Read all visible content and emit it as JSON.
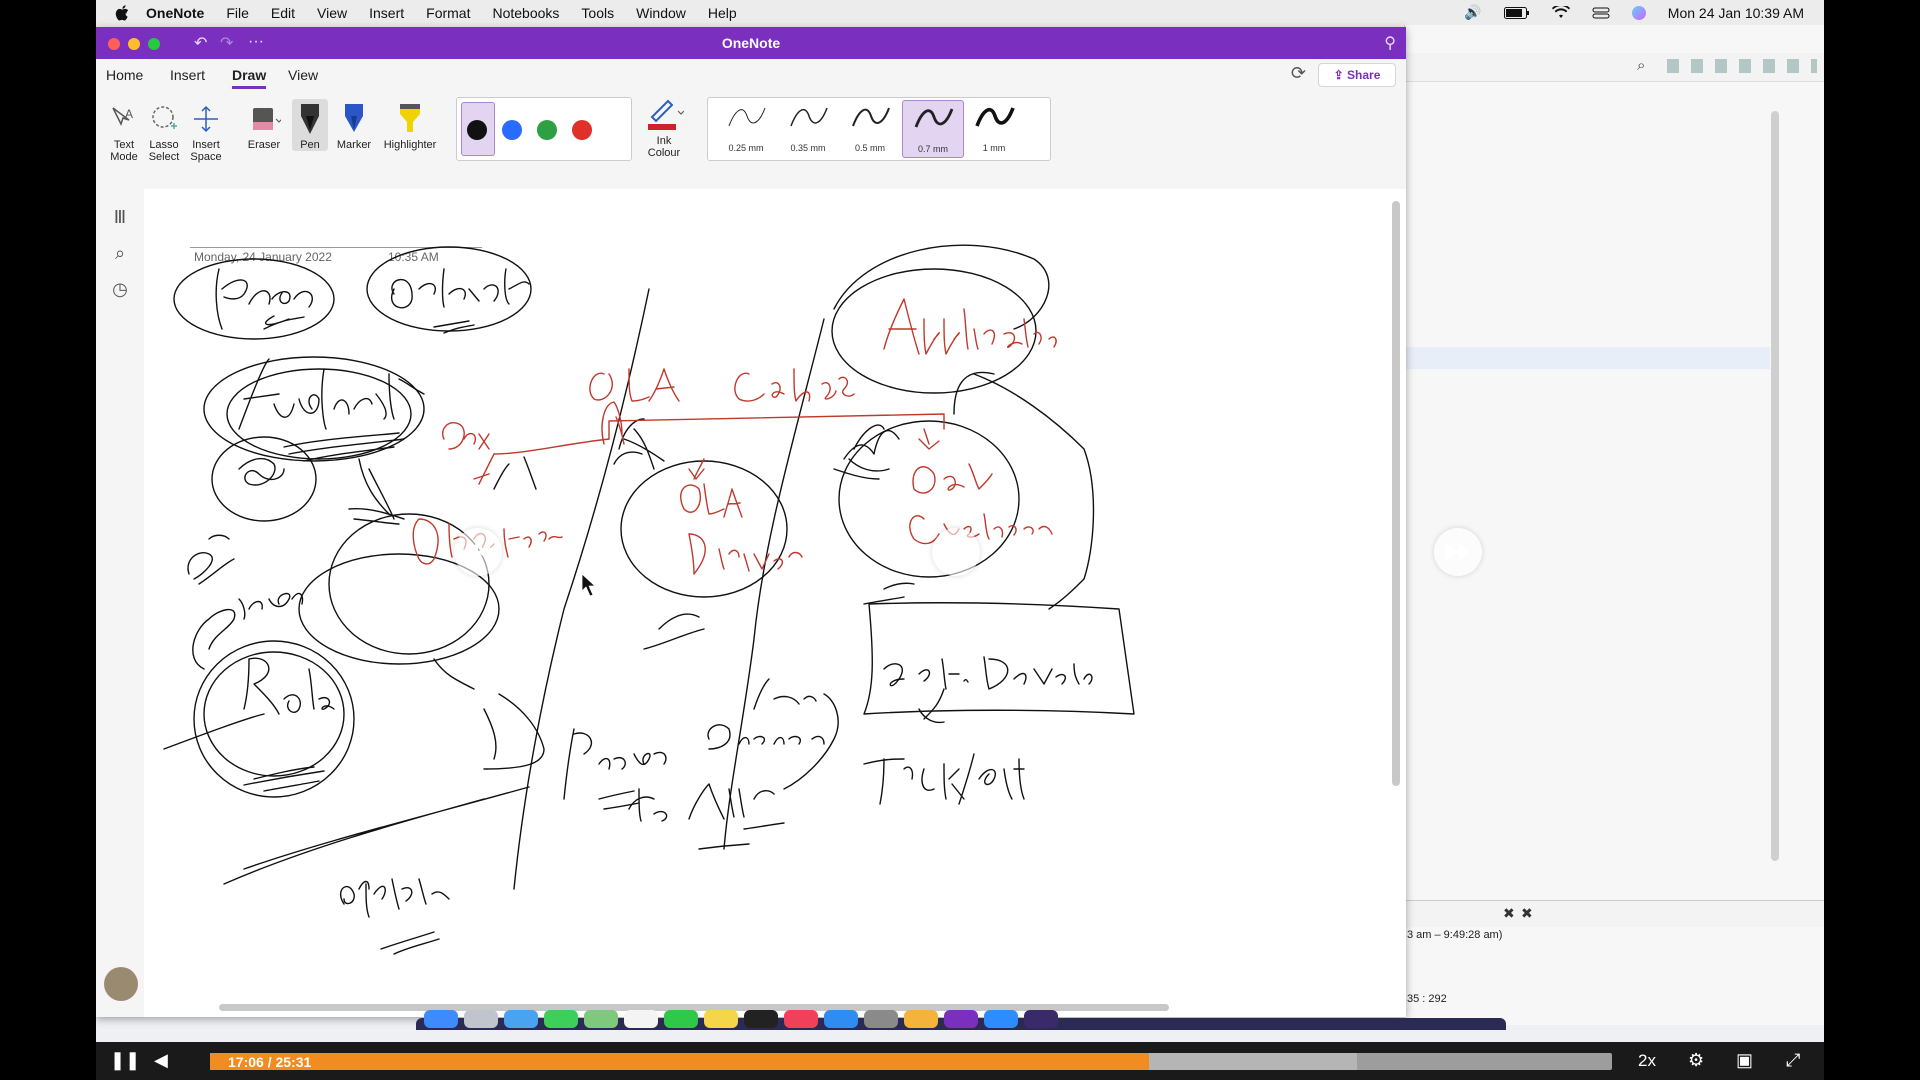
{
  "menubar": {
    "app_name": "OneNote",
    "items": [
      "File",
      "Edit",
      "View",
      "Insert",
      "Format",
      "Notebooks",
      "Tools",
      "Window",
      "Help"
    ],
    "clock": "Mon 24 Jan  10:39 AM"
  },
  "window": {
    "title": "OneNote",
    "tabs": [
      "Home",
      "Insert",
      "Draw",
      "View"
    ],
    "active_tab": "Draw",
    "share_label": "Share"
  },
  "ribbon": {
    "tools": [
      {
        "label": "Text Mode",
        "icon": "text-mode-icon"
      },
      {
        "label": "Lasso Select",
        "icon": "lasso-icon"
      },
      {
        "label": "Insert Space",
        "icon": "insert-space-icon"
      },
      {
        "label": "Eraser",
        "icon": "eraser-icon"
      },
      {
        "label": "Pen",
        "icon": "pen-icon"
      },
      {
        "label": "Marker",
        "icon": "marker-icon"
      },
      {
        "label": "Highlighter",
        "icon": "highlighter-icon"
      }
    ],
    "ink_colour_label": "Ink Colour",
    "colors": [
      "#111111",
      "#2a6bff",
      "#2ea043",
      "#e0302a"
    ],
    "selected_color": "#111111",
    "thicknesses": [
      "0.25 mm",
      "0.35 mm",
      "0.5 mm",
      "0.7 mm",
      "1 mm"
    ],
    "selected_thickness": "0.7 mm"
  },
  "page": {
    "date": "Monday, 24 January 2022",
    "time": "10:35 AM"
  },
  "bg_app": {
    "time_range": "3 am – 9:49:28 am)",
    "coords": "35 : 292"
  },
  "video": {
    "time": "17:06 / 25:31",
    "progress": 0.67,
    "buffered": 0.818,
    "rate": "2x"
  },
  "colors": {
    "accent": "#7b2fbe",
    "ink_red": "#c0392b",
    "progress": "#f28b20"
  }
}
